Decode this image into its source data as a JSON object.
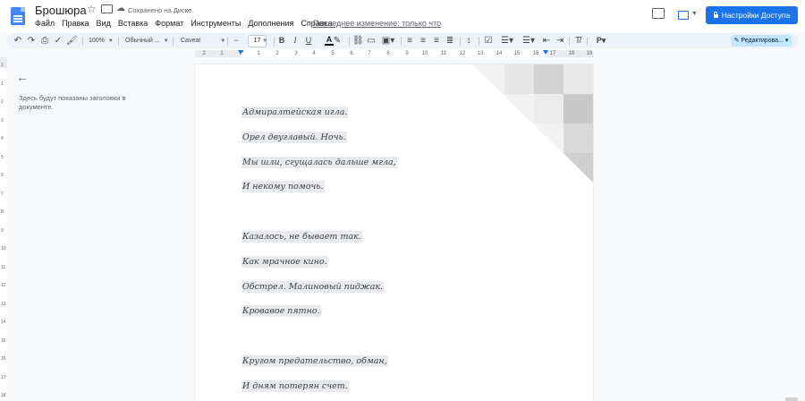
{
  "app": {
    "title": "Брошюра",
    "save_status": "Сохранено на Диске.",
    "last_edit": "Последнее изменение: только что",
    "share_label": "Настройки Доступа"
  },
  "menu": [
    "Файл",
    "Правка",
    "Вид",
    "Вставка",
    "Формат",
    "Инструменты",
    "Дополнения",
    "Справка"
  ],
  "toolbar": {
    "zoom": "100%",
    "style": "Обычный ...",
    "font": "Caveat",
    "font_size": "17",
    "editing_mode": "Редактирова..."
  },
  "ruler": {
    "ticks": [
      "2",
      "1",
      "1",
      "2",
      "3",
      "4",
      "5",
      "6",
      "7",
      "8",
      "9",
      "10",
      "11",
      "12",
      "13",
      "14",
      "15",
      "16",
      "17",
      "18",
      "19"
    ],
    "vticks": [
      "1",
      "1",
      "2",
      "3",
      "4",
      "5",
      "6",
      "7",
      "8",
      "9",
      "10",
      "11",
      "12",
      "13",
      "14",
      "15",
      "16",
      "17",
      "18"
    ]
  },
  "outline": {
    "placeholder": "Здесь будут показаны заголовки в документе."
  },
  "document": {
    "lines": [
      "Адмиралтейская игла.",
      "Орел двуглавый. Ночь.",
      "Мы шли, сгущалась дальше мгла,",
      "И некому помочь.",
      "",
      "Казалось, не бывает так.",
      "Как мрачное кино.",
      "Обстрел. Малиновый пиджак.",
      "Кровавое пятно.",
      "",
      "Кругом предательство, обман,",
      "И дням потерян счет."
    ]
  },
  "colors": {
    "accent": "#1a73e8",
    "toolbar_bg": "#edf2fa",
    "edit_mode_bg": "#c2e7ff",
    "text_highlight": "#e8eaed"
  },
  "icons": [
    "docs-logo-icon",
    "star-icon",
    "folder-icon",
    "cloud-saved-icon",
    "comment-icon",
    "present-icon",
    "lock-icon",
    "undo-icon",
    "redo-icon",
    "print-icon",
    "spellcheck-icon",
    "paint-format-icon",
    "bold-icon",
    "italic-icon",
    "underline-icon",
    "text-color-icon",
    "highlight-icon",
    "link-icon",
    "add-comment-icon",
    "insert-image-icon",
    "align-left-icon",
    "align-center-icon",
    "align-right-icon",
    "align-justify-icon",
    "line-spacing-icon",
    "checklist-icon",
    "bullet-list-icon",
    "numbered-list-icon",
    "decrease-indent-icon",
    "increase-indent-icon",
    "clear-formatting-icon",
    "input-tools-icon",
    "pencil-icon",
    "back-arrow-icon"
  ]
}
